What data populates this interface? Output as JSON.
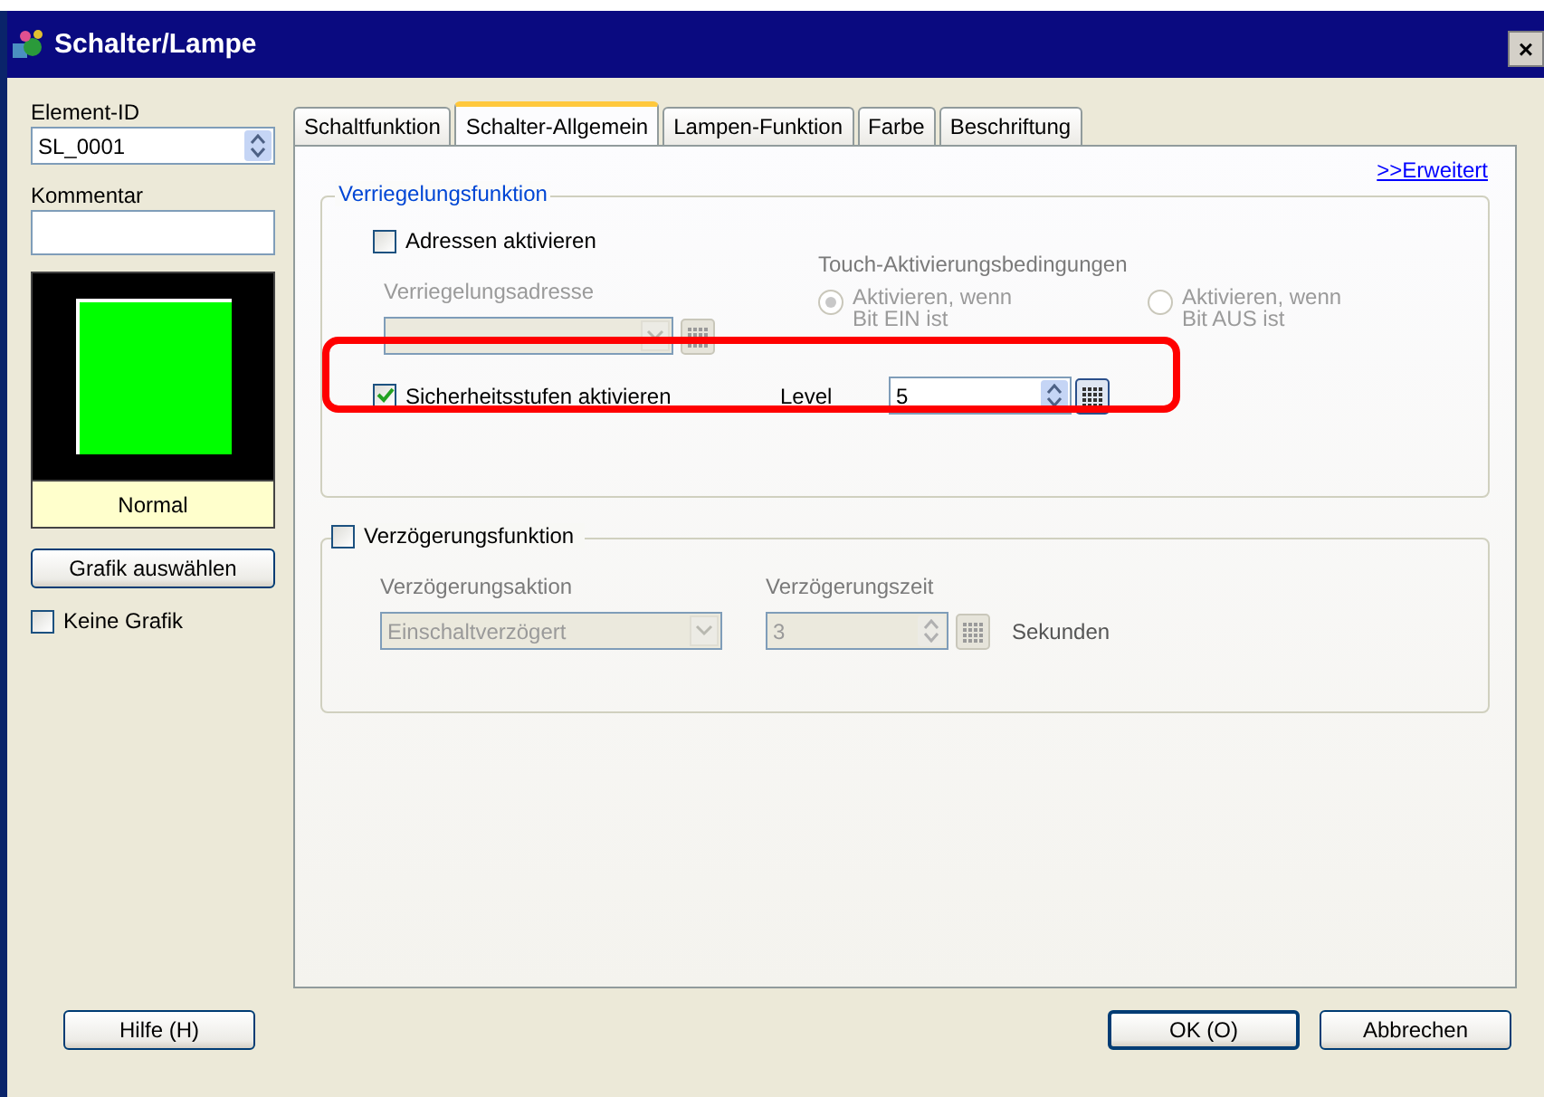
{
  "window": {
    "title": "Schalter/Lampe",
    "close": "×"
  },
  "left": {
    "element_id_label": "Element-ID",
    "element_id_value": "SL_0001",
    "comment_label": "Kommentar",
    "preview_state": "Normal",
    "select_graphic_button": "Grafik auswählen",
    "no_graphic": {
      "label": "Keine Grafik",
      "checked": false
    }
  },
  "tabs": [
    {
      "label": "Schaltfunktion",
      "selected": false
    },
    {
      "label": "Schalter-Allgemein",
      "selected": true
    },
    {
      "label": "Lampen-Funktion",
      "selected": false
    },
    {
      "label": "Farbe",
      "selected": false
    },
    {
      "label": "Beschriftung",
      "selected": false
    }
  ],
  "advanced_link": ">>Erweitert",
  "interlock": {
    "title": "Verriegelungsfunktion",
    "address_checkbox": {
      "label": "Adressen aktivieren",
      "checked": false
    },
    "address_label": "Verriegelungsadresse",
    "disabled": true,
    "touch_label": "Touch-Aktivierungsbedingungen",
    "radios": [
      {
        "label": "Aktivieren, wenn",
        "label_2": "Bit EIN ist",
        "selected": true
      },
      {
        "label": "Aktivieren, wenn",
        "label_2": "Bit AUS ist",
        "selected": false
      }
    ],
    "security_checkbox": {
      "label": "Sicherheitsstufen aktivieren",
      "checked": true
    },
    "level_label": "Level",
    "level_value": "5"
  },
  "delay": {
    "checkbox": {
      "label": "Verzögerungsfunktion",
      "checked": false
    },
    "disabled": true,
    "action_label": "Verzögerungsaktion",
    "action_value": "Einschaltverzögert",
    "time_label": "Verzögerungszeit",
    "time_value": "3",
    "unit": "Sekunden"
  },
  "buttons": {
    "help": "Hilfe (H)",
    "ok": "OK (O)",
    "cancel": "Abbrechen"
  }
}
